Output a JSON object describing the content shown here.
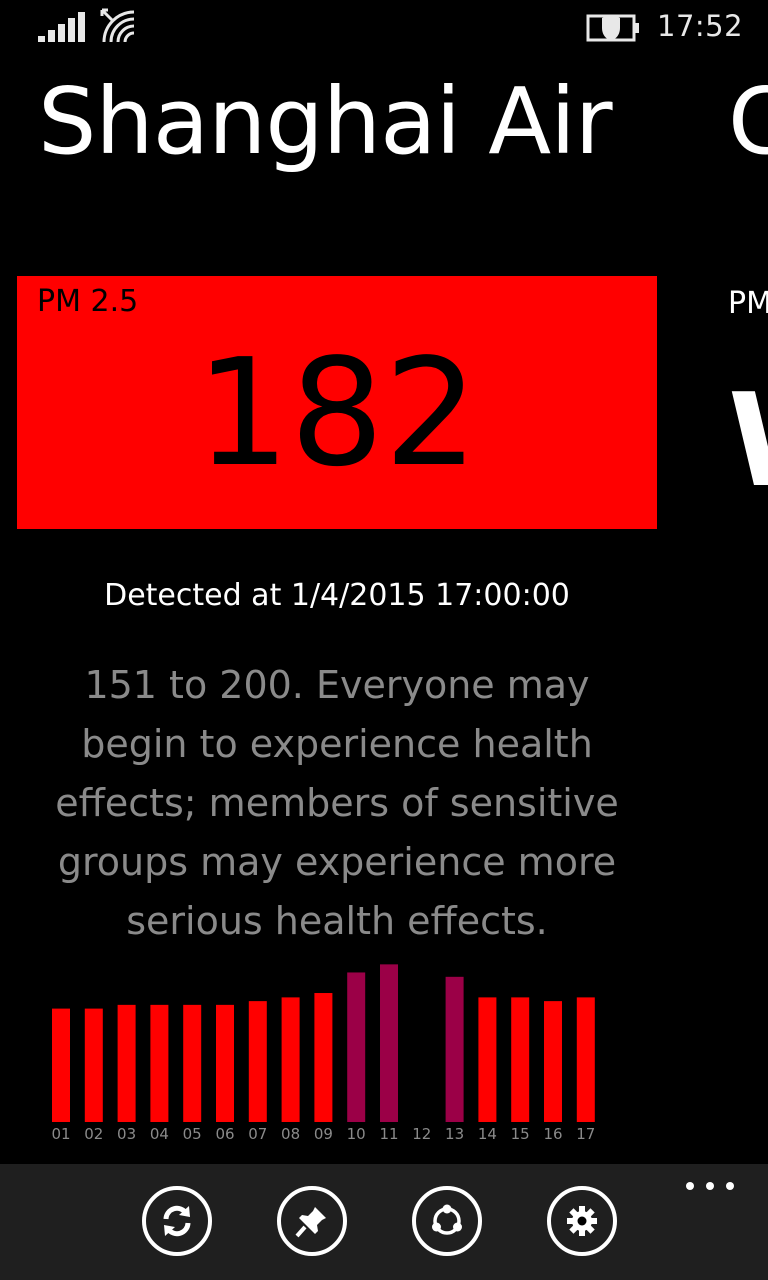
{
  "status_bar": {
    "time": "17:52"
  },
  "app": {
    "title": "Shanghai Air",
    "next_panel_title": "C"
  },
  "pm_tile": {
    "label": "PM 2.5",
    "value": "182",
    "color": "#ff0000"
  },
  "next_panel": {
    "label": "PM",
    "value": "W"
  },
  "detected": "Detected at 1/4/2015 17:00:00",
  "description": "151 to 200. Everyone may begin to experience health effects; members of sensitive groups may experience more serious health effects.",
  "chart_data": {
    "type": "bar",
    "categories": [
      "01",
      "02",
      "03",
      "04",
      "05",
      "06",
      "07",
      "08",
      "09",
      "10",
      "11",
      "12",
      "13",
      "14",
      "15",
      "16",
      "17"
    ],
    "values": [
      182,
      182,
      188,
      188,
      188,
      188,
      194,
      200,
      207,
      240,
      253,
      null,
      233,
      200,
      200,
      194,
      200
    ],
    "colors": [
      "#ff0000",
      "#ff0000",
      "#ff0000",
      "#ff0000",
      "#ff0000",
      "#ff0000",
      "#ff0000",
      "#ff0000",
      "#ff0000",
      "#9b0047",
      "#9b0047",
      "#ff0000",
      "#9b0047",
      "#ff0000",
      "#ff0000",
      "#ff0000",
      "#ff0000"
    ],
    "ylim": [
      0,
      260
    ]
  },
  "app_bar": {
    "buttons": [
      {
        "name": "refresh-button",
        "icon": "refresh-icon"
      },
      {
        "name": "pin-button",
        "icon": "pin-icon"
      },
      {
        "name": "share-button",
        "icon": "share-icon"
      },
      {
        "name": "settings-button",
        "icon": "gear-icon"
      }
    ],
    "more": "..."
  }
}
